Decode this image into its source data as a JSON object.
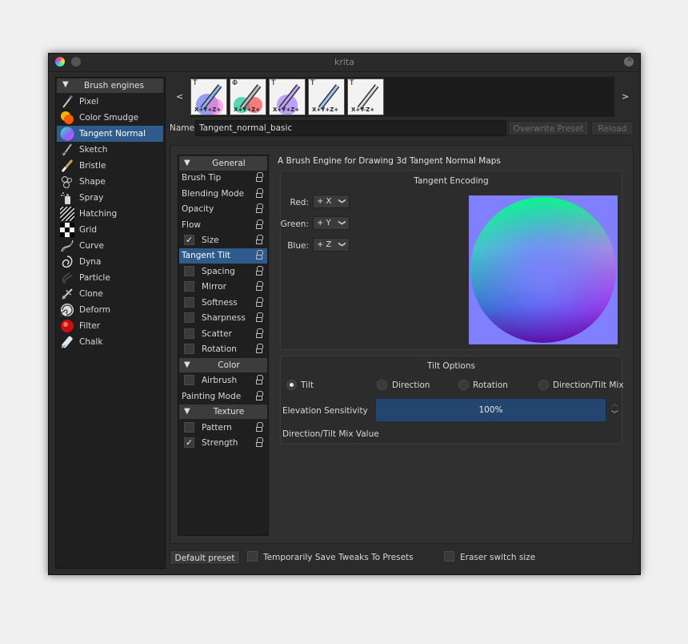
{
  "window": {
    "title": "krita"
  },
  "sidebar": {
    "header": "Brush engines",
    "items": [
      {
        "label": "Pixel",
        "icon": "pixel-brush-icon"
      },
      {
        "label": "Color Smudge",
        "icon": "color-smudge-icon"
      },
      {
        "label": "Tangent Normal",
        "icon": "tangent-normal-icon",
        "selected": true
      },
      {
        "label": "Sketch",
        "icon": "sketch-brush-icon"
      },
      {
        "label": "Bristle",
        "icon": "bristle-brush-icon"
      },
      {
        "label": "Shape",
        "icon": "shape-brush-icon"
      },
      {
        "label": "Spray",
        "icon": "spray-brush-icon"
      },
      {
        "label": "Hatching",
        "icon": "hatching-brush-icon"
      },
      {
        "label": "Grid",
        "icon": "grid-brush-icon"
      },
      {
        "label": "Curve",
        "icon": "curve-brush-icon"
      },
      {
        "label": "Dyna",
        "icon": "dyna-brush-icon"
      },
      {
        "label": "Particle",
        "icon": "particle-brush-icon"
      },
      {
        "label": "Clone",
        "icon": "clone-brush-icon"
      },
      {
        "label": "Deform",
        "icon": "deform-brush-icon"
      },
      {
        "label": "Filter",
        "icon": "filter-brush-icon"
      },
      {
        "label": "Chalk",
        "icon": "chalk-brush-icon"
      }
    ]
  },
  "presets": {
    "prev": "<",
    "next": ">",
    "items": [
      {
        "mark": "T",
        "axes": "X+Y+Z+"
      },
      {
        "mark": "Φ",
        "axes": "X+Y+Z+"
      },
      {
        "mark": "T",
        "axes": "X+Y+Z+"
      },
      {
        "mark": "T",
        "axes": "X+Y+Z+"
      },
      {
        "mark": "T",
        "axes": "X+Y-Z+"
      }
    ]
  },
  "name_row": {
    "label": "Name:",
    "value": "Tangent_normal_basic",
    "overwrite": "Overwrite Preset",
    "reload": "Reload"
  },
  "options": {
    "groups": {
      "general": "General",
      "color": "Color",
      "texture": "Texture"
    },
    "items": {
      "brush_tip": "Brush Tip",
      "blending_mode": "Blending Mode",
      "opacity": "Opacity",
      "flow": "Flow",
      "size": "Size",
      "tangent_tilt": "Tangent Tilt",
      "spacing": "Spacing",
      "mirror": "Mirror",
      "softness": "Softness",
      "sharpness": "Sharpness",
      "scatter": "Scatter",
      "rotation": "Rotation",
      "airbrush": "Airbrush",
      "painting_mode": "Painting Mode",
      "pattern": "Pattern",
      "strength": "Strength"
    },
    "check": "✓",
    "collapse_arrow": "▼"
  },
  "engine_description": "A Brush Engine for Drawing 3d Tangent Normal Maps",
  "encoding": {
    "title": "Tangent Encoding",
    "red_label": "Red:",
    "red_value": "+ X",
    "green_label": "Green:",
    "green_value": "+ Y",
    "blue_label": "Blue:",
    "blue_value": "+ Z",
    "chevron": "❯"
  },
  "tilt": {
    "title": "Tilt Options",
    "modes": [
      "Tilt",
      "Direction",
      "Rotation",
      "Direction/Tilt Mix"
    ],
    "elevation_label": "Elevation Sensitivity",
    "elevation_value": "100%",
    "mix_label": "Direction/Tilt Mix Value"
  },
  "bottom": {
    "default_preset": "Default preset",
    "save_tweaks": "Temporarily Save Tweaks To Presets",
    "eraser_switch": "Eraser switch size"
  },
  "colors": {
    "selection": "#2f5b8c",
    "background": "#2b2b2b",
    "normal_map_base": "#8080ff"
  }
}
